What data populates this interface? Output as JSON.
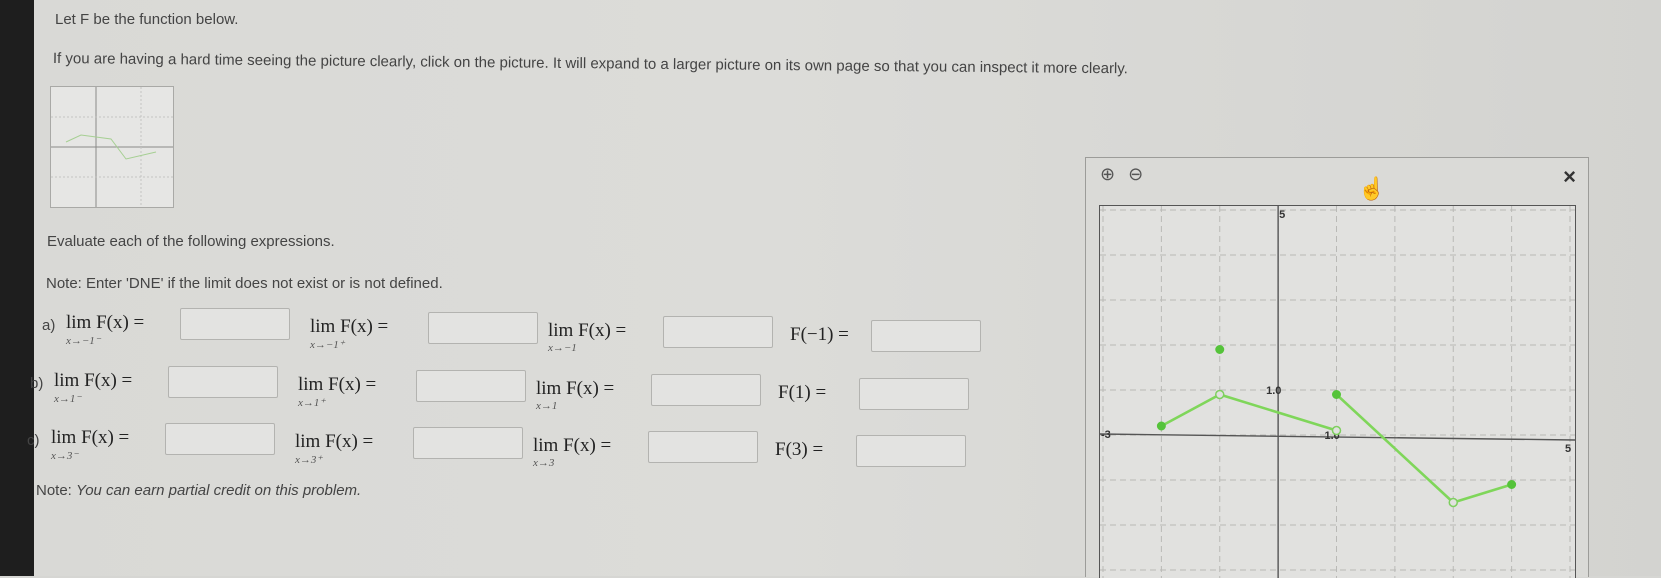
{
  "intro": {
    "line1": "Let F be the function below.",
    "line2": "If you are having a hard time seeing the picture clearly, click on the picture. It will expand to a larger picture on its own page so that you can inspect it more clearly."
  },
  "instructions": {
    "evaluate": "Evaluate each of the following expressions.",
    "note_dne": "Note: Enter 'DNE' if the limit does not exist or is not defined.",
    "note_partial_label": "Note:",
    "note_partial": "You can earn partial credit on this problem."
  },
  "rows": [
    {
      "label": "a)",
      "items": [
        {
          "expr": "lim F(x) =",
          "sub": "x→−1⁻"
        },
        {
          "expr": "lim F(x) =",
          "sub": "x→−1⁺"
        },
        {
          "expr": "lim F(x) =",
          "sub": "x→−1"
        },
        {
          "expr": "F(−1) =",
          "sub": ""
        }
      ]
    },
    {
      "label": "b)",
      "items": [
        {
          "expr": "lim F(x) =",
          "sub": "x→1⁻"
        },
        {
          "expr": "lim F(x) =",
          "sub": "x→1⁺"
        },
        {
          "expr": "lim F(x) =",
          "sub": "x→1"
        },
        {
          "expr": "F(1) =",
          "sub": ""
        }
      ]
    },
    {
      "label": "c)",
      "items": [
        {
          "expr": "lim F(x) =",
          "sub": "x→3⁻"
        },
        {
          "expr": "lim F(x) =",
          "sub": "x→3⁺"
        },
        {
          "expr": "lim F(x) =",
          "sub": "x→3"
        },
        {
          "expr": "F(3) =",
          "sub": ""
        }
      ]
    }
  ],
  "popup": {
    "zoom_in": "⊕",
    "zoom_out": "⊖",
    "close": "×",
    "cursor": "☝",
    "axis_labels": {
      "y_top": "5",
      "x_left": "-3",
      "x_right": "5",
      "mark_y": "1.0",
      "mark_x": "1.0"
    }
  },
  "graph": {
    "xlim": [
      -3,
      5
    ],
    "ylim": [
      -2,
      5
    ],
    "segments": [
      [
        [
          -2,
          0.2
        ],
        [
          -1,
          0.9
        ]
      ],
      [
        [
          -1,
          0.9
        ],
        [
          1,
          0.1
        ]
      ],
      [
        [
          1,
          0.9
        ],
        [
          3,
          -1.5
        ]
      ],
      [
        [
          3,
          -1.5
        ],
        [
          4,
          -1.1
        ]
      ]
    ],
    "closed_points": [
      [
        -2,
        0.2
      ],
      [
        -1,
        1.9
      ],
      [
        1,
        0.9
      ],
      [
        4,
        -1.1
      ]
    ],
    "open_points": [
      [
        -1,
        0.9
      ],
      [
        1,
        0.1
      ],
      [
        3,
        -1.5
      ]
    ],
    "color": "#7fd65a"
  }
}
